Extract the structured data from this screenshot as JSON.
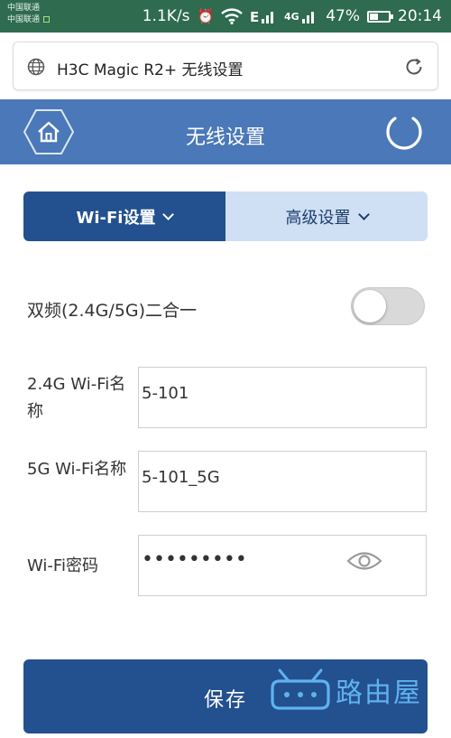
{
  "status_bar": {
    "carrier_1": "中国联通",
    "carrier_2": "中国联通",
    "speed": "1.1K/s",
    "signal_2": "4G",
    "battery": "47%",
    "battery_level": 0.47,
    "time": "20:14"
  },
  "browser": {
    "page_title": "H3C Magic R2+ 无线设置"
  },
  "header": {
    "title": "无线设置"
  },
  "tabs": [
    {
      "label": "Wi-Fi设置",
      "active": true
    },
    {
      "label": "高级设置",
      "active": false
    }
  ],
  "dual_band": {
    "label": "双频(2.4G/5G)二合一",
    "enabled": false
  },
  "fields": {
    "wifi_24_name": {
      "label": "2.4G Wi-Fi名称",
      "value": "5-101"
    },
    "wifi_5g_name": {
      "label": "5G Wi-Fi名称",
      "value": "5-101_5G"
    },
    "wifi_password": {
      "label": "Wi-Fi密码",
      "value": "•••••••••"
    }
  },
  "actions": {
    "save_label": "保存"
  },
  "watermark": {
    "text": "路由屋"
  },
  "colors": {
    "header_blue": "#4a78b8",
    "primary_dark": "#23508f",
    "tab_inactive": "#cfe0f5",
    "status_bar": "#2e6b4f",
    "watermark": "#5fb2ef"
  }
}
